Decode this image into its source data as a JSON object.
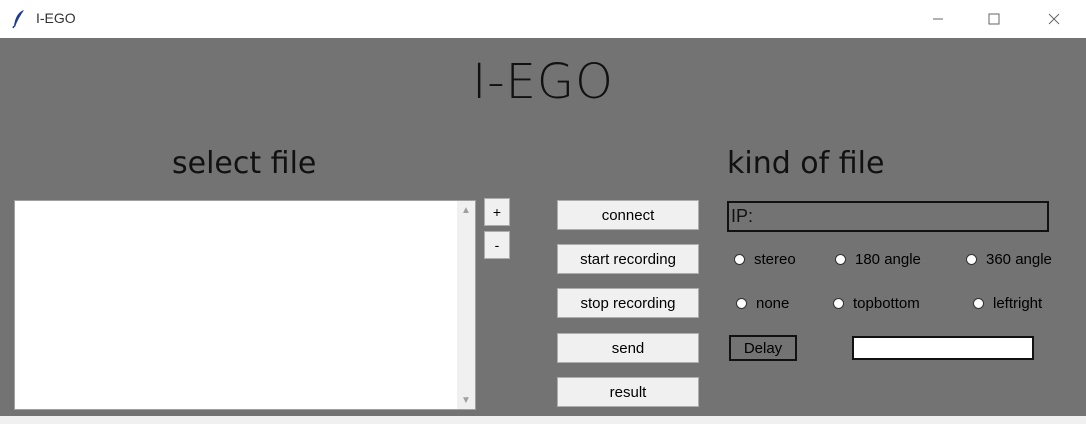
{
  "window": {
    "title": "I-EGO"
  },
  "header": {
    "title": "I-EGO"
  },
  "left": {
    "heading": "select file",
    "add_label": "+",
    "remove_label": "-"
  },
  "actions": {
    "connect": "connect",
    "start": "start recording",
    "stop": "stop recording",
    "send": "send",
    "result": "result"
  },
  "right": {
    "heading": "kind of file",
    "ip_value": "IP:",
    "radios_row1": [
      "stereo",
      "180 angle",
      "360 angle"
    ],
    "radios_row2": [
      "none",
      "topbottom",
      "leftright"
    ],
    "delay_label": "Delay",
    "delay_value": ""
  },
  "colors": {
    "background": "#737373",
    "button": "#f0f0f0"
  }
}
